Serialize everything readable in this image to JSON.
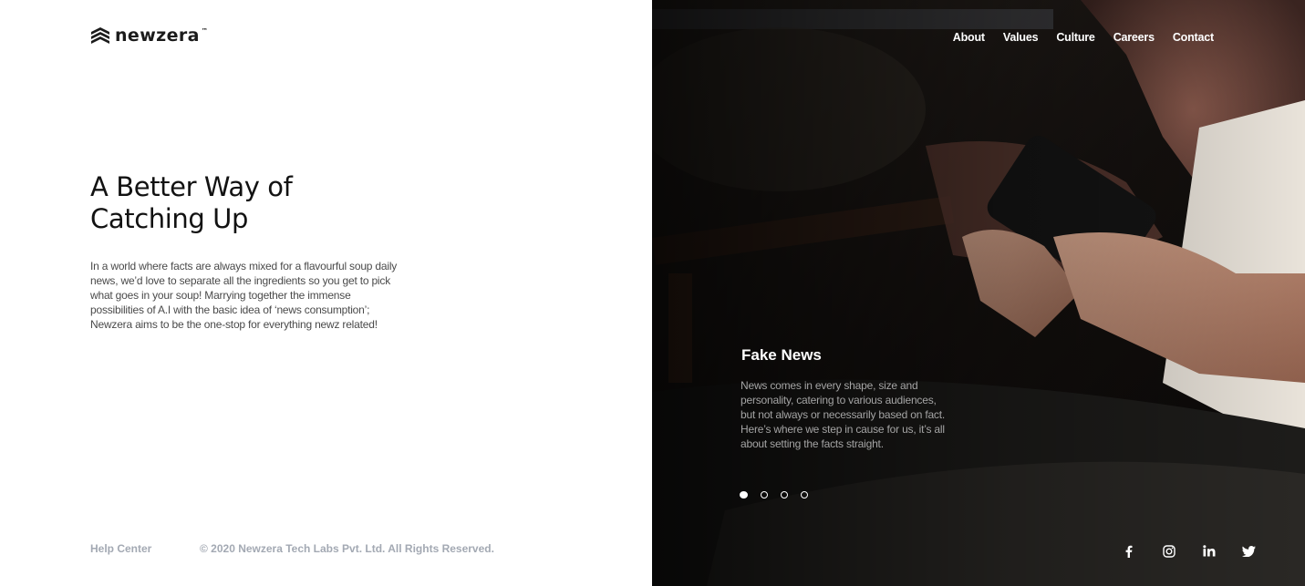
{
  "brand": {
    "name": "newzera",
    "trademark": "™"
  },
  "hero": {
    "headline": "A Better Way of Catching Up",
    "intro": "In a world where facts are always mixed for a flavourful soup daily news, we’d love to separate all the ingredients so you get to pick what goes in your soup! Marrying together the immense possibilities of A.I with the basic idea of ‘news consumption’; Newzera aims to be the one-stop for everything newz related!"
  },
  "footer": {
    "help_label": "Help Center",
    "copyright": "© 2020 Newzera Tech Labs Pvt. Ltd. All Rights Reserved."
  },
  "nav": {
    "items": [
      {
        "label": "About"
      },
      {
        "label": "Values"
      },
      {
        "label": "Culture"
      },
      {
        "label": "Careers"
      },
      {
        "label": "Contact"
      }
    ]
  },
  "slide": {
    "title": "Fake News",
    "text": "News comes in every shape, size and personality, catering to various audiences, but not always or necessarily based on fact. Here’s where we step in cause for us, it’s all about setting the facts straight.",
    "count": 4,
    "active_index": 0
  },
  "social": {
    "icons": [
      "facebook-icon",
      "instagram-icon",
      "linkedin-icon",
      "twitter-icon"
    ]
  },
  "colors": {
    "text_dark": "#121212",
    "muted_footer": "#a3a9b3",
    "panel_dark": "#0e0c0b",
    "white": "#ffffff"
  }
}
